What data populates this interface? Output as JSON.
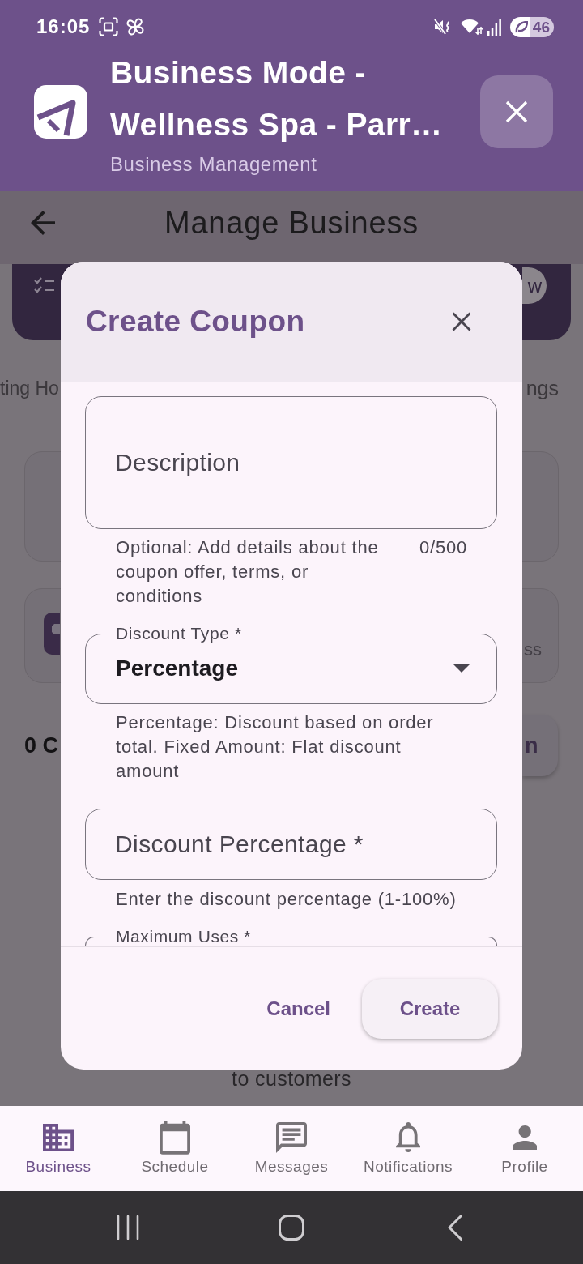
{
  "status_bar": {
    "time": "16:05",
    "battery": "46"
  },
  "header": {
    "title": "Business Mode - Wellness Spa - Parr…",
    "subtitle": "Business Management"
  },
  "background_screen": {
    "title": "Manage Business",
    "banner_button": "w",
    "tabs": [
      {
        "label": "ting Ho"
      },
      {
        "label": "ngs"
      }
    ],
    "card_text": "ss",
    "summary_text": "0 C",
    "action_button": "n",
    "footer_text": "to customers"
  },
  "dialog": {
    "title": "Create Coupon",
    "fields": [
      {
        "kind": "textarea",
        "placeholder": "Description",
        "helper": "Optional: Add details about the coupon offer, terms, or conditions",
        "counter": "0/500"
      },
      {
        "kind": "dropdown",
        "label": "Discount Type *",
        "value": "Percentage",
        "helper": "Percentage: Discount based on order total. Fixed Amount: Flat discount amount"
      },
      {
        "kind": "text",
        "placeholder": "Discount Percentage *",
        "helper": "Enter the discount percentage (1-100%)"
      },
      {
        "kind": "partial",
        "label": "Maximum Uses *"
      }
    ],
    "buttons": [
      {
        "kind": "text",
        "label": "Cancel"
      },
      {
        "kind": "elevated",
        "label": "Create"
      }
    ]
  },
  "bottom_nav": [
    {
      "label": "Business",
      "selected": true
    },
    {
      "label": "Schedule",
      "selected": false
    },
    {
      "label": "Messages",
      "selected": false
    },
    {
      "label": "Notifications",
      "selected": false
    },
    {
      "label": "Profile",
      "selected": false
    }
  ]
}
